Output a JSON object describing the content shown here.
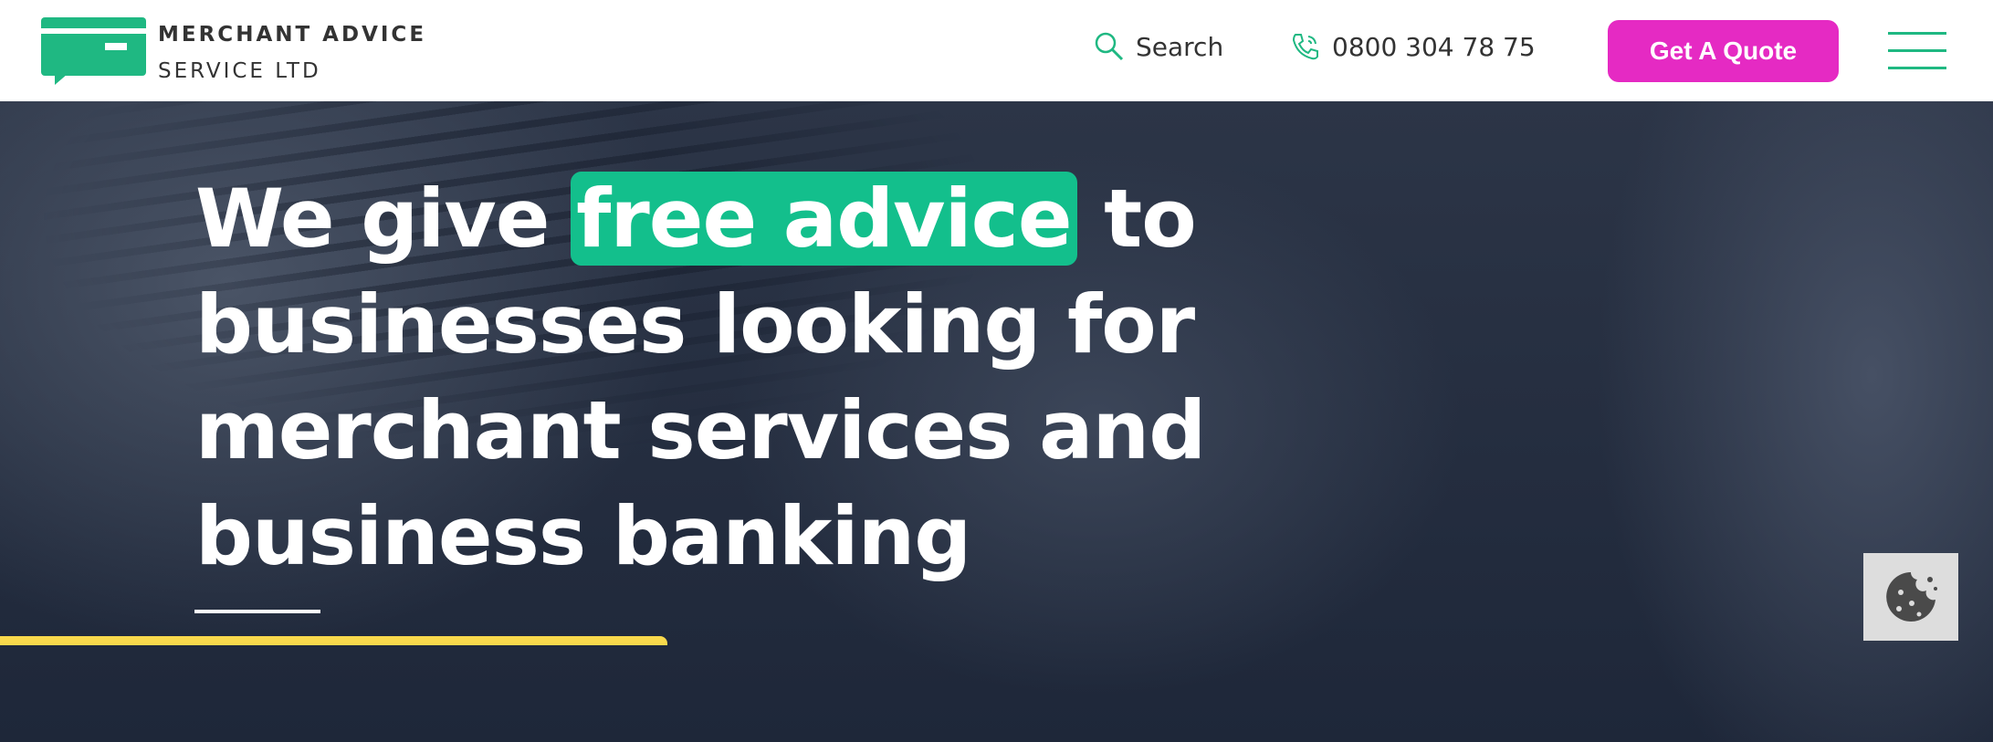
{
  "header": {
    "brand_line1": "MERCHANT ADVICE",
    "brand_line2": "SERVICE LTD",
    "search_label": "Search",
    "phone": "0800 304 78 75",
    "quote_label": "Get A Quote"
  },
  "hero": {
    "line1_before": "We give ",
    "line1_highlight": "free advice",
    "line1_after": " to",
    "line2": "businesses looking for",
    "line3": "merchant services and",
    "line4": "business banking"
  },
  "colors": {
    "brand_green": "#1fb882",
    "highlight": "#13bf8c",
    "cta_pink": "#e52ac3",
    "accent_yellow": "#f9d94c"
  }
}
